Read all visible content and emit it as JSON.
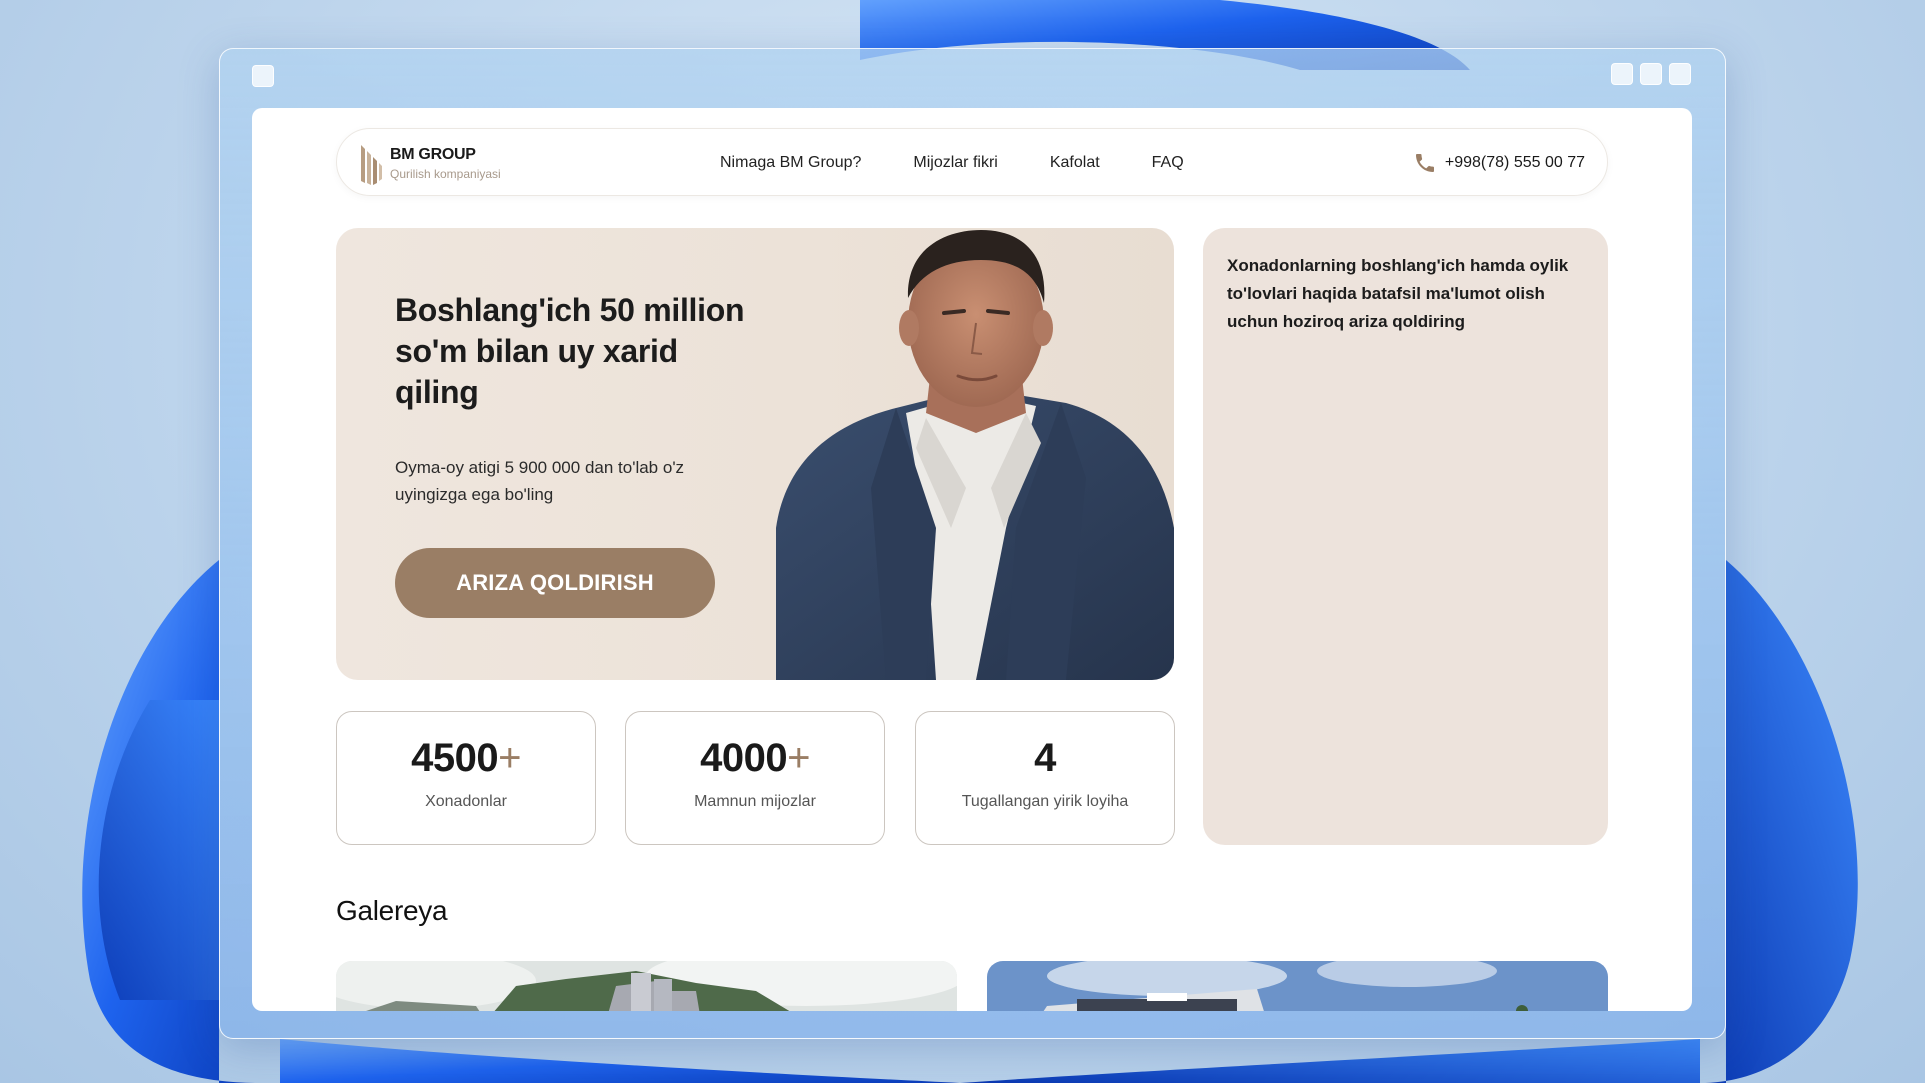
{
  "header": {
    "logo_title": "BM GROUP",
    "logo_subtitle": "Qurilish kompaniyasi",
    "nav": [
      "Nimaga BM Group?",
      "Mijozlar fikri",
      "Kafolat",
      "FAQ"
    ],
    "phone": "+998(78) 555 00 77"
  },
  "hero": {
    "title": "Boshlang'ich 50 million so'm bilan uy xarid qiling",
    "description": "Oyma-oy atigi 5 900 000 dan to'lab o'z uyingizga ega bo'ling",
    "button": "ARIZA QOLDIRISH"
  },
  "form_panel": {
    "text": "Xonadonlarning boshlang'ich hamda oylik to'lovlari haqida batafsil ma'lumot olish uchun hoziroq ariza qoldiring"
  },
  "stats": [
    {
      "value": "4500",
      "suffix": "+",
      "label": "Xonadonlar"
    },
    {
      "value": "4000",
      "suffix": "+",
      "label": "Mamnun mijozlar"
    },
    {
      "value": "4",
      "suffix": "",
      "label": "Tugallangan yirik loyiha"
    }
  ],
  "gallery": {
    "title": "Galereya"
  },
  "colors": {
    "accent": "#9a7e65",
    "hero_bg": "#ece2d8",
    "panel_bg": "#ede3dc",
    "wallpaper_blue": "#1e5fe6"
  }
}
